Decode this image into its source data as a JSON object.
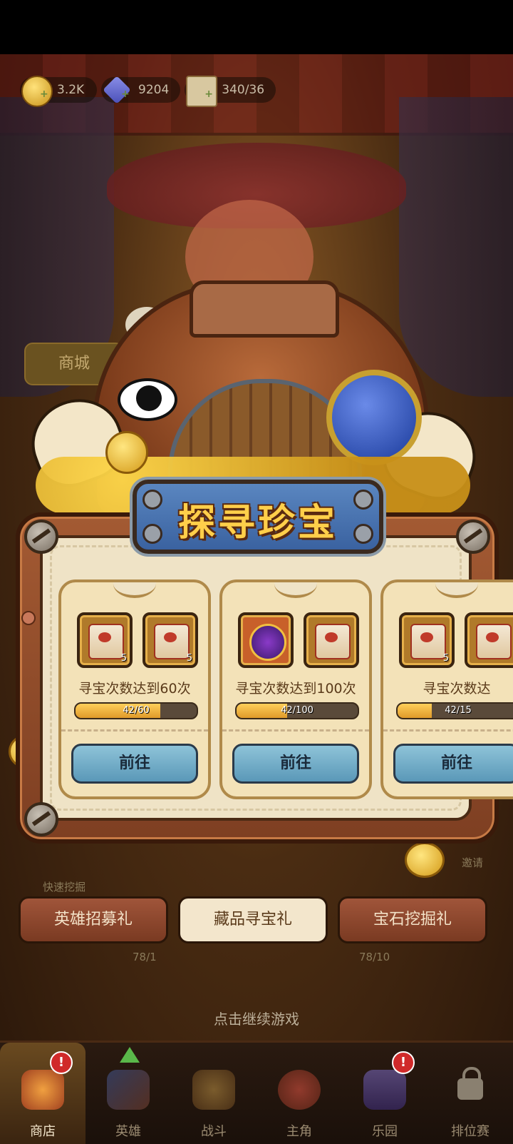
{
  "resources": {
    "gold": "3.2K",
    "gems": "9204",
    "scrolls": "340/36"
  },
  "shop_tab_label": "商城",
  "popup": {
    "title": "探寻珍宝",
    "tasks": [
      {
        "requirement": "寻宝次数达到60次",
        "progress_text": "42/60",
        "progress": 0.7,
        "rewards": [
          {
            "icon": "scroll-icon",
            "count": "5"
          },
          {
            "icon": "scroll-icon",
            "count": "5"
          }
        ],
        "button": "前往"
      },
      {
        "requirement": "寻宝次数达到100次",
        "progress_text": "42/100",
        "progress": 0.42,
        "rewards": [
          {
            "icon": "amulet-icon",
            "count": ""
          },
          {
            "icon": "scroll-icon",
            "count": ""
          }
        ],
        "button": "前往"
      },
      {
        "requirement": "寻宝次数达",
        "progress_text": "42/15",
        "progress": 0.28,
        "rewards": [
          {
            "icon": "scroll-icon",
            "count": "5"
          }
        ],
        "button": "前往"
      }
    ]
  },
  "gift_tabs": [
    "英雄招募礼",
    "藏品寻宝礼",
    "宝石挖掘礼"
  ],
  "behind": {
    "quick_dig": "快速挖掘",
    "left_count": "78/1",
    "right_count": "78/10",
    "invite": "邀请"
  },
  "continue_hint": "点击继续游戏",
  "nav": [
    {
      "label": "商店"
    },
    {
      "label": "英雄"
    },
    {
      "label": "战斗"
    },
    {
      "label": "主角"
    },
    {
      "label": "乐园"
    },
    {
      "label": "排位赛"
    }
  ],
  "colors": {
    "title_gold": "#ffcf4a",
    "banner_blue": "#4a76b0",
    "button_blue": "#6fa8c6",
    "progress_orange": "#f0b040"
  }
}
